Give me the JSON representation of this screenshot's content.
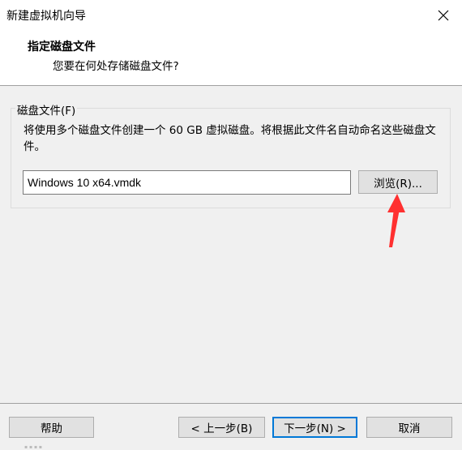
{
  "window": {
    "title": "新建虚拟机向导",
    "close_icon": "close-icon"
  },
  "header": {
    "title": "指定磁盘文件",
    "subtitle": "您要在何处存储磁盘文件?"
  },
  "disk_file": {
    "group_label": "磁盘文件(F)",
    "description": "将使用多个磁盘文件创建一个 60 GB 虚拟磁盘。将根据此文件名自动命名这些磁盘文件。",
    "path_value": "Windows 10 x64.vmdk",
    "browse_label": "浏览(R)..."
  },
  "footer": {
    "help_label": "帮助",
    "back_label": "< 上一步(B)",
    "next_label": "下一步(N) >",
    "cancel_label": "取消"
  },
  "colors": {
    "accent": "#0078d7",
    "annotation_arrow": "#ff3030",
    "background": "#f0f0f0"
  }
}
